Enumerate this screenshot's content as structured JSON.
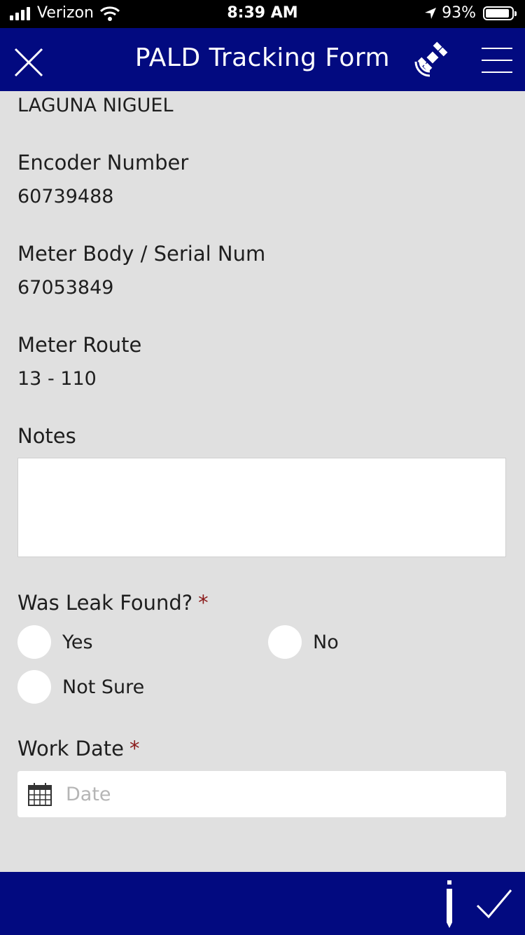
{
  "status_bar": {
    "carrier": "Verizon",
    "time": "8:39 AM",
    "battery": "93%",
    "battery_level": 0.93,
    "icons": [
      "signal-icon",
      "wifi-icon",
      "location-arrow-icon",
      "battery-icon"
    ]
  },
  "header": {
    "title": "PALD Tracking Form",
    "icons": [
      "close-icon",
      "satellite-icon",
      "menu-icon"
    ]
  },
  "form": {
    "city": "LAGUNA NIGUEL",
    "encoder": {
      "label": "Encoder Number",
      "value": "60739488"
    },
    "meter_body": {
      "label": "Meter Body / Serial Num",
      "value": "67053849"
    },
    "meter_route": {
      "label": "Meter Route",
      "value": "13 - 110"
    },
    "notes": {
      "label": "Notes",
      "value": ""
    },
    "leak": {
      "label": "Was Leak Found?",
      "required_mark": "*",
      "options": [
        "Yes",
        "No",
        "Not Sure"
      ]
    },
    "work_date": {
      "label": "Work Date",
      "required_mark": "*",
      "placeholder": "Date",
      "icon": "calendar-icon"
    }
  },
  "bottom_bar": {
    "icons": [
      "info-icon",
      "checkmark-icon"
    ]
  },
  "colors": {
    "header_bg": "#020a80",
    "page_bg": "#e0e0e0",
    "required": "#8b1a1a"
  }
}
